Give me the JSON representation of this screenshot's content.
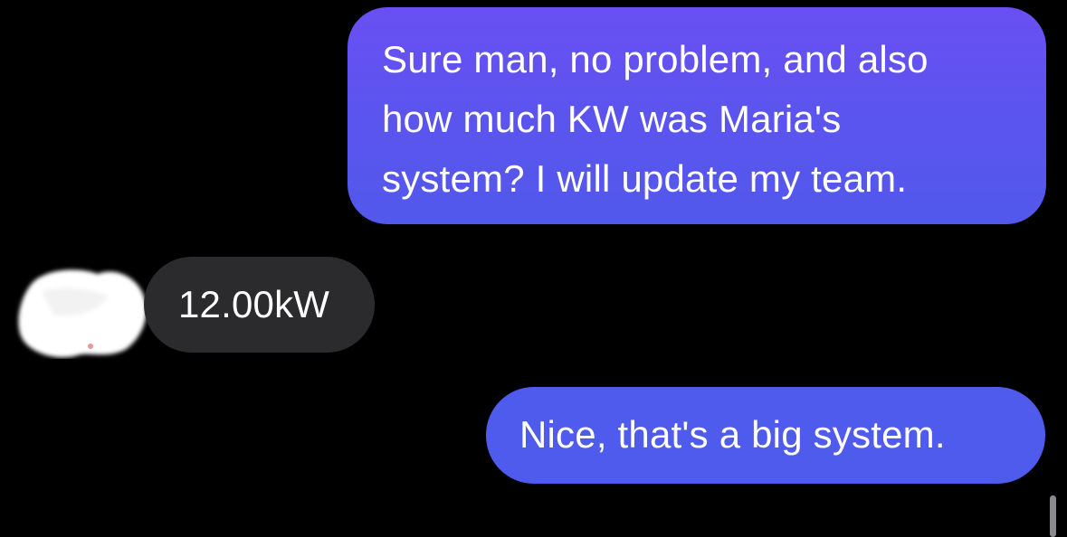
{
  "conversation": {
    "messages": [
      {
        "direction": "outgoing",
        "lines": [
          "Sure man, no problem, and also",
          "how much KW was Maria's",
          "system? I will update my team."
        ]
      },
      {
        "direction": "incoming",
        "text": "12.00kW",
        "avatar": "redacted-avatar"
      },
      {
        "direction": "outgoing",
        "text": "Nice, that's a big system."
      }
    ]
  },
  "colors": {
    "background": "#000000",
    "outgoing_bubble": "#5a55ee",
    "incoming_bubble": "#2b2b2d",
    "text": "#ffffff"
  }
}
